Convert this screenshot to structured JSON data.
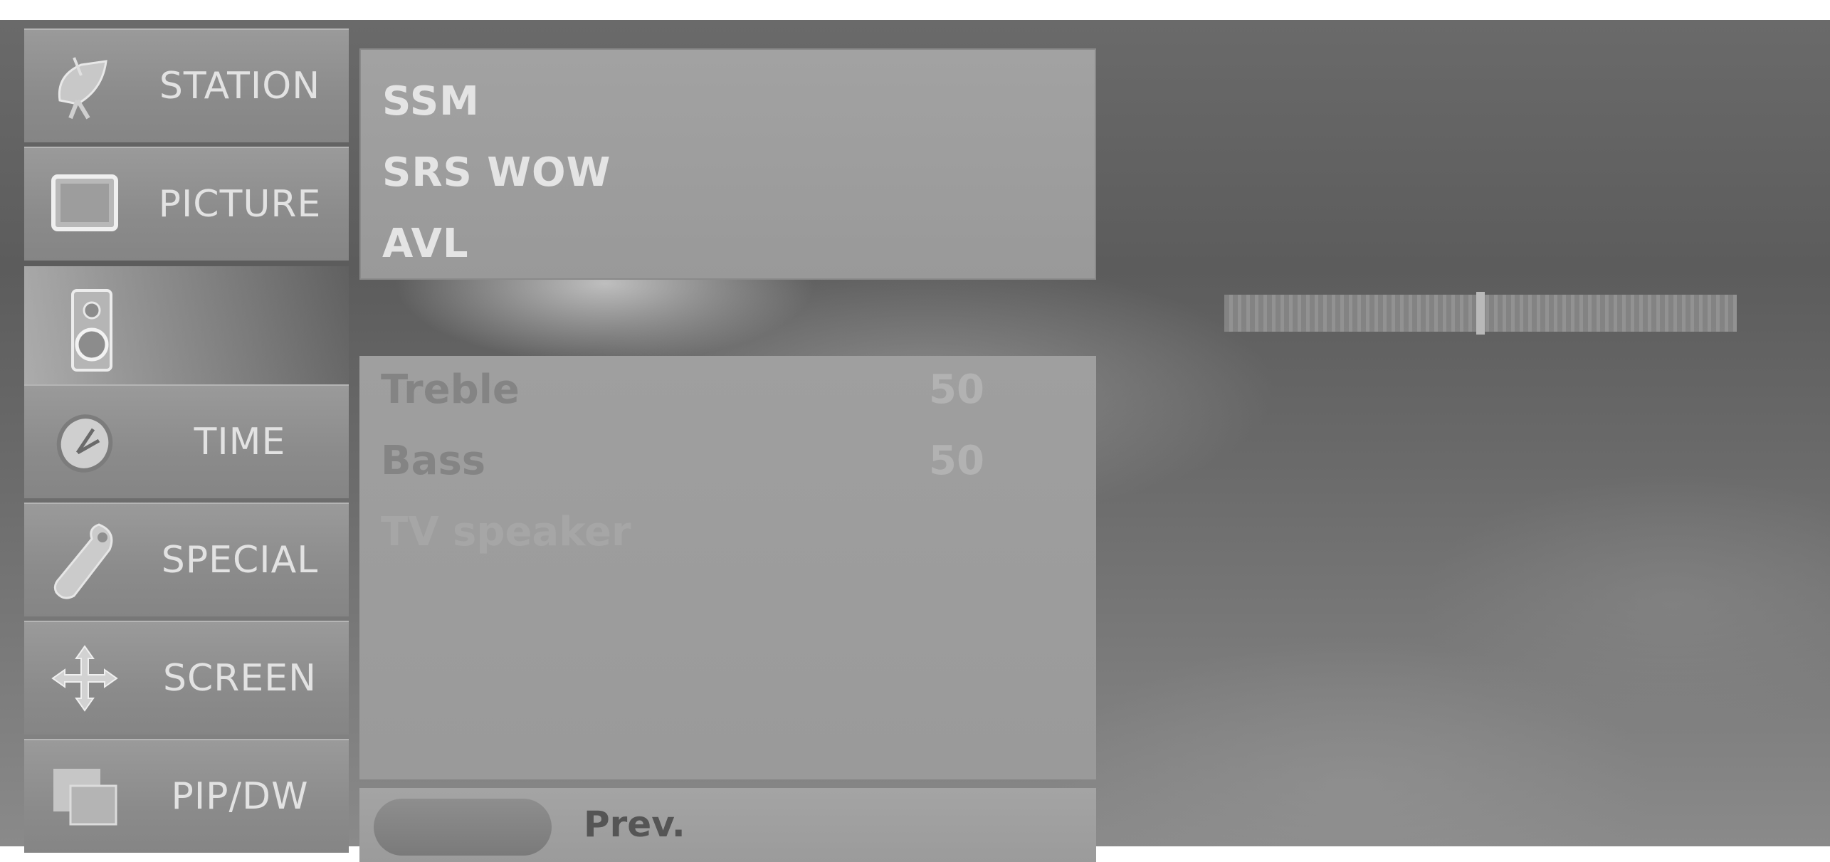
{
  "menu": {
    "items": [
      {
        "label": "STATION",
        "icon": "satellite-dish-icon"
      },
      {
        "label": "PICTURE",
        "icon": "tv-screen-icon"
      },
      {
        "label": "",
        "icon": "speaker-icon"
      },
      {
        "label": "TIME",
        "icon": "clock-icon"
      },
      {
        "label": "SPECIAL",
        "icon": "tag-icon"
      },
      {
        "label": "SCREEN",
        "icon": "move-arrows-icon"
      },
      {
        "label": "PIP/DW",
        "icon": "pip-windows-icon"
      }
    ]
  },
  "submenu": {
    "items": [
      "SSM",
      "SRS WOW",
      "AVL"
    ]
  },
  "level_bar": {
    "value": 50,
    "max": 100
  },
  "sound": {
    "rows": [
      {
        "name": "Treble",
        "value": "50"
      },
      {
        "name": "Bass",
        "value": "50"
      },
      {
        "name": "TV speaker",
        "value": ""
      }
    ]
  },
  "footer": {
    "prev_label": "Prev."
  },
  "colors": {
    "panel": "#9f9f9f",
    "menu_tile": "#8f8f8f",
    "text_light": "#e2e2e2",
    "background": "#5f5f5f"
  }
}
